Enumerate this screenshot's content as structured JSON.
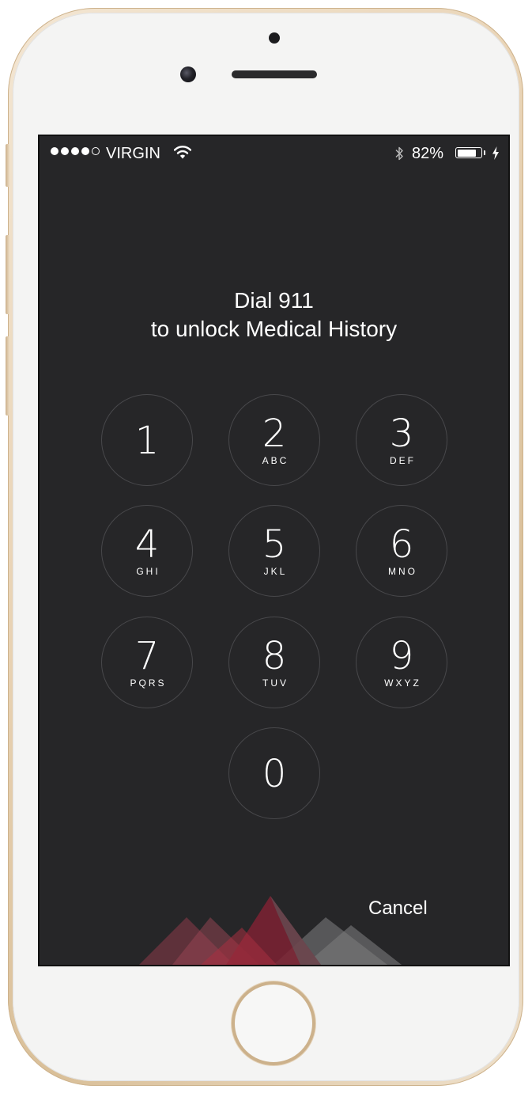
{
  "status_bar": {
    "signal_filled": 4,
    "signal_total": 5,
    "carrier": "VIRGIN",
    "battery_percent_text": "82%",
    "battery_level": 0.82
  },
  "prompt": {
    "line1": "Dial 911",
    "line2": "to unlock Medical History"
  },
  "keypad": {
    "keys": [
      {
        "digit": "1",
        "letters": ""
      },
      {
        "digit": "2",
        "letters": "ABC"
      },
      {
        "digit": "3",
        "letters": "DEF"
      },
      {
        "digit": "4",
        "letters": "GHI"
      },
      {
        "digit": "5",
        "letters": "JKL"
      },
      {
        "digit": "6",
        "letters": "MNO"
      },
      {
        "digit": "7",
        "letters": "PQRS"
      },
      {
        "digit": "8",
        "letters": "TUV"
      },
      {
        "digit": "9",
        "letters": "WXYZ"
      },
      {
        "digit": "0",
        "letters": ""
      }
    ]
  },
  "cancel_label": "Cancel",
  "colors": {
    "screen_background": "#262628",
    "key_ring": "#48484b",
    "text": "#ffffff",
    "logo_red": "#9b2a3c",
    "logo_gray": "#6a6a6c",
    "frame_gold": "#e8d2b3"
  },
  "icons": {
    "wifi": "wifi-icon",
    "bluetooth": "bluetooth-icon",
    "battery": "battery-icon",
    "charging": "charging-bolt-icon",
    "logo": "mountains-logo"
  }
}
